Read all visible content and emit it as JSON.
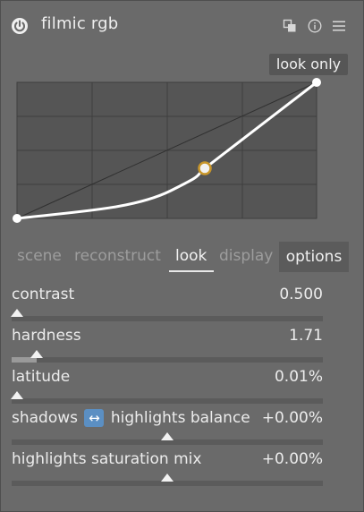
{
  "module": {
    "title": "filmic rgb",
    "icons": [
      "power-icon",
      "copy-icon",
      "info-icon",
      "menu-icon"
    ]
  },
  "graph": {
    "label": "look only"
  },
  "tabs": [
    {
      "label": "scene",
      "active": false
    },
    {
      "label": "reconstruct",
      "active": false
    },
    {
      "label": "look",
      "active": true
    },
    {
      "label": "display",
      "active": false
    },
    {
      "label": "options",
      "active": false
    }
  ],
  "sliders": [
    {
      "label": "contrast",
      "value": "0.500",
      "level": 0.0
    },
    {
      "label": "hardness",
      "value": "1.71",
      "level": 0.08
    },
    {
      "label": "latitude",
      "value": "0.01%",
      "level": 0.0
    },
    {
      "label_left": "shadows",
      "label_right": "highlights balance",
      "value": "+0.00%",
      "level": 0.5
    },
    {
      "label": "highlights saturation mix",
      "value": "+0.00%",
      "level": 0.5
    }
  ],
  "colors": {
    "background": "#6a6a6a",
    "graph_bg": "#555555",
    "accent_node": "#c8962a",
    "swap_icon": "#5b8fc3"
  }
}
